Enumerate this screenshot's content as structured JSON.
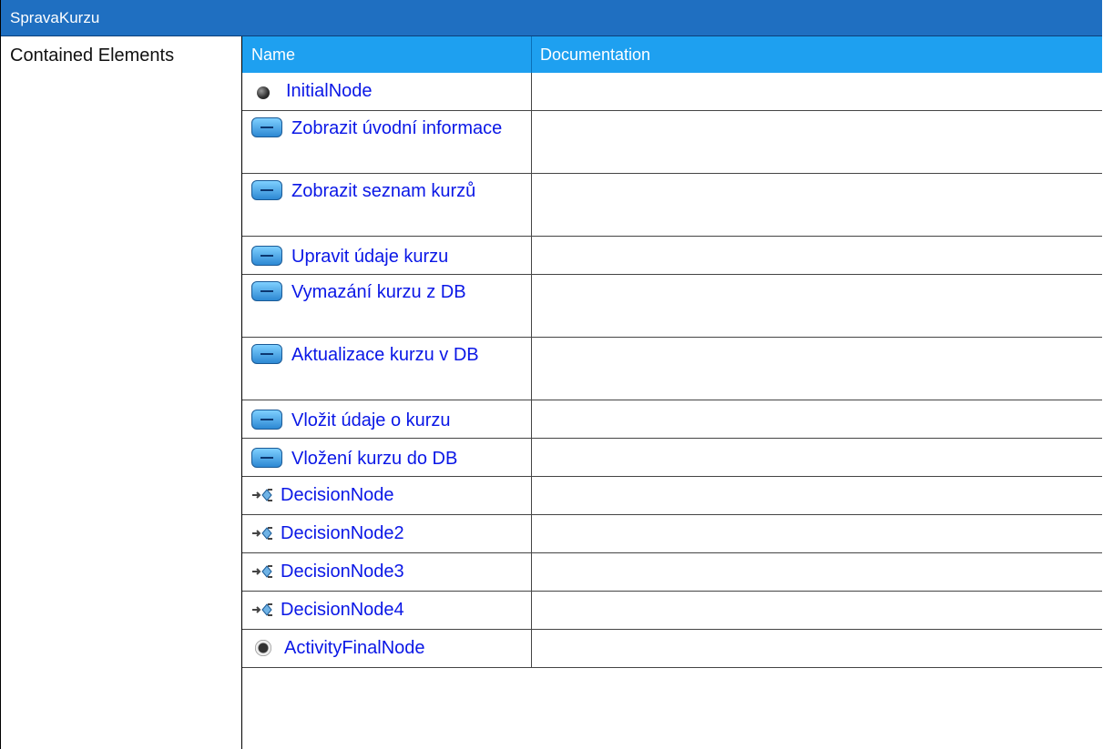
{
  "window": {
    "title": "SpravaKurzu"
  },
  "left": {
    "label": "Contained Elements"
  },
  "table": {
    "headers": {
      "name": "Name",
      "documentation": "Documentation"
    },
    "rows": [
      {
        "icon": "initial-node-icon",
        "name": "InitialNode",
        "documentation": ""
      },
      {
        "icon": "action-icon",
        "name": "Zobrazit úvodní informace",
        "documentation": ""
      },
      {
        "icon": "action-icon",
        "name": "Zobrazit seznam kurzů",
        "documentation": ""
      },
      {
        "icon": "action-icon",
        "name": "Upravit údaje kurzu",
        "documentation": ""
      },
      {
        "icon": "action-icon",
        "name": "Vymazání kurzu z DB",
        "documentation": ""
      },
      {
        "icon": "action-icon",
        "name": "Aktualizace kurzu v DB",
        "documentation": ""
      },
      {
        "icon": "action-icon",
        "name": "Vložit údaje o kurzu",
        "documentation": ""
      },
      {
        "icon": "action-icon",
        "name": "Vložení kurzu do DB",
        "documentation": ""
      },
      {
        "icon": "decision-node-icon",
        "name": "DecisionNode",
        "documentation": ""
      },
      {
        "icon": "decision-node-icon",
        "name": "DecisionNode2",
        "documentation": ""
      },
      {
        "icon": "decision-node-icon",
        "name": "DecisionNode3",
        "documentation": ""
      },
      {
        "icon": "decision-node-icon",
        "name": "DecisionNode4",
        "documentation": ""
      },
      {
        "icon": "activity-final-node-icon",
        "name": "ActivityFinalNode",
        "documentation": ""
      }
    ]
  }
}
